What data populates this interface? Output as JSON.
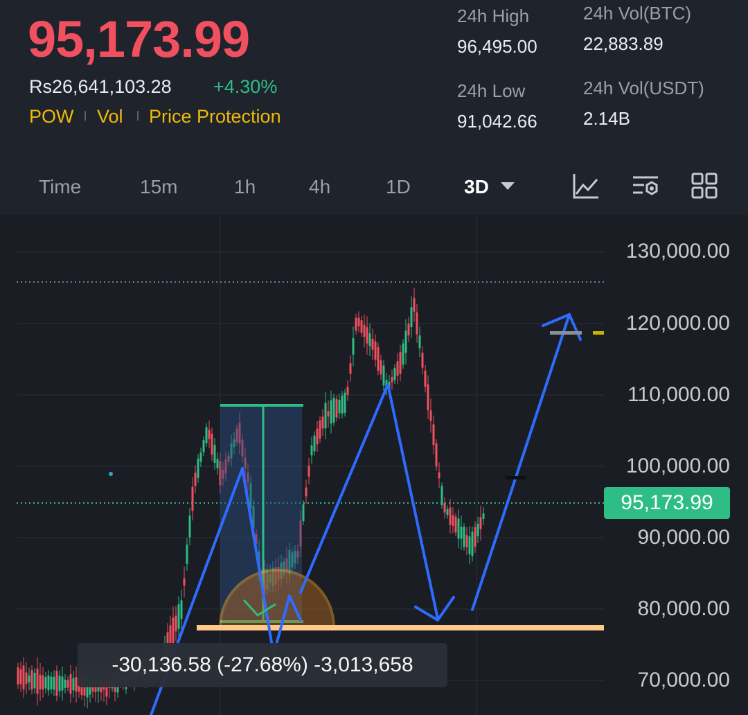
{
  "header": {
    "last_price": "95,173.99",
    "fiat_price": "Rs26,641,103.28",
    "change_pct": "+4.30%",
    "tags": [
      "POW",
      "Vol",
      "Price Protection"
    ]
  },
  "stats": {
    "high_label": "24h High",
    "high_value": "96,495.00",
    "low_label": "24h Low",
    "low_value": "91,042.66",
    "vol_btc_label": "24h Vol(BTC)",
    "vol_btc_value": "22,883.89",
    "vol_usdt_label": "24h Vol(USDT)",
    "vol_usdt_value": "2.14B"
  },
  "timeframes": [
    "Time",
    "15m",
    "1h",
    "4h",
    "1D",
    "3D"
  ],
  "active_timeframe": "3D",
  "icons": [
    "indicator-chart-icon",
    "settings-sliders-icon",
    "grid-layout-icon"
  ],
  "chart": {
    "y_axis_labels": [
      "130,000.00",
      "120,000.00",
      "110,000.00",
      "100,000.00",
      "90,000.00",
      "80,000.00",
      "70,000.00"
    ],
    "current_price_tag": "95,173.99",
    "measure_readout": "-30,136.58 (-27.68%) -3,013,658"
  },
  "colors": {
    "up": "#2ebd85",
    "down": "#f0505f",
    "accent": "#f0b90b",
    "annotation_arrow": "#2f6bff",
    "support_line": "#ffc98a"
  }
}
